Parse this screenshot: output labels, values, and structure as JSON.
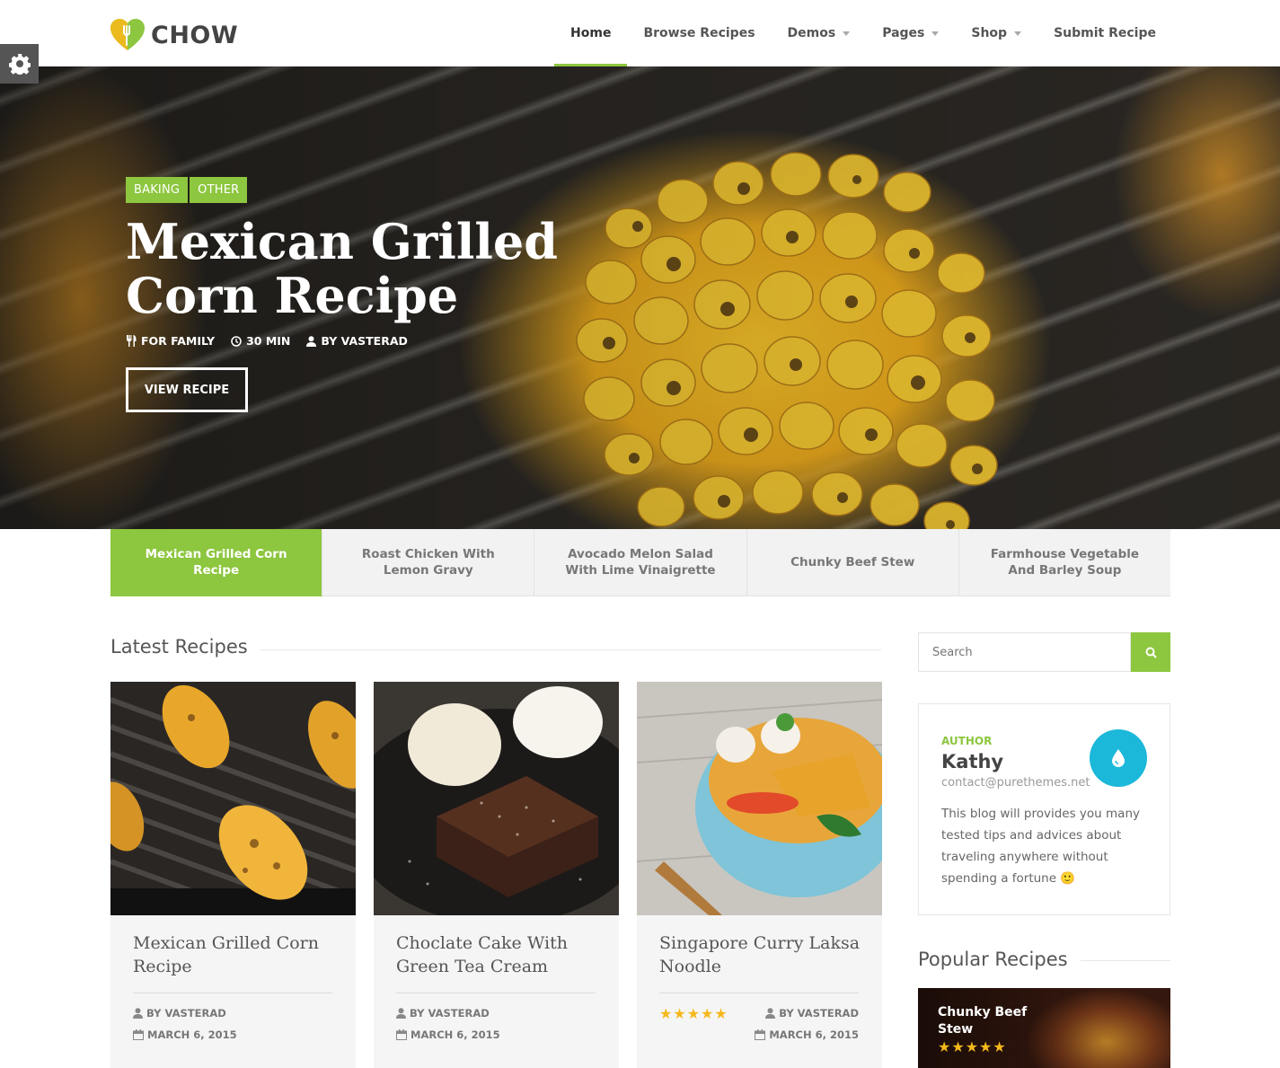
{
  "brand": {
    "name": "CHOW",
    "accent": "#8dc63f"
  },
  "nav": {
    "items": [
      {
        "label": "Home"
      },
      {
        "label": "Browse Recipes"
      },
      {
        "label": "Demos"
      },
      {
        "label": "Pages"
      },
      {
        "label": "Shop"
      },
      {
        "label": "Submit Recipe"
      }
    ]
  },
  "hero": {
    "tags": [
      "BAKING",
      "OTHER"
    ],
    "title": "Mexican Grilled Corn Recipe",
    "meta": {
      "serves": "FOR FAMILY",
      "time": "30 MIN",
      "author": "BY VASTERAD"
    },
    "button": "VIEW RECIPE"
  },
  "slider_tabs": [
    "Mexican Grilled Corn Recipe",
    "Roast Chicken With Lemon Gravy",
    "Avocado Melon Salad With Lime Vinaigrette",
    "Chunky Beef Stew",
    "Farmhouse Vegetable And Barley Soup"
  ],
  "latest": {
    "title": "Latest Recipes",
    "cards": [
      {
        "title": "Mexican Grilled Corn Recipe",
        "author": "BY VASTERAD",
        "date": "MARCH 6, 2015",
        "rating": 0
      },
      {
        "title": "Choclate Cake With Green Tea Cream",
        "author": "BY VASTERAD",
        "date": "MARCH 6, 2015",
        "rating": 0
      },
      {
        "title": "Singapore Curry Laksa Noodle",
        "author": "BY VASTERAD",
        "date": "MARCH 6, 2015",
        "rating": 5
      }
    ]
  },
  "sidebar": {
    "search_placeholder": "Search",
    "author": {
      "label": "AUTHOR",
      "name": "Kathy",
      "email": "contact@purethemes.net",
      "bio": "This blog will provides you many tested tips and advices about traveling anywhere without spending a fortune 🙂"
    },
    "popular": {
      "title": "Popular Recipes",
      "items": [
        {
          "title": "Chunky Beef Stew",
          "rating": 5
        }
      ]
    }
  }
}
